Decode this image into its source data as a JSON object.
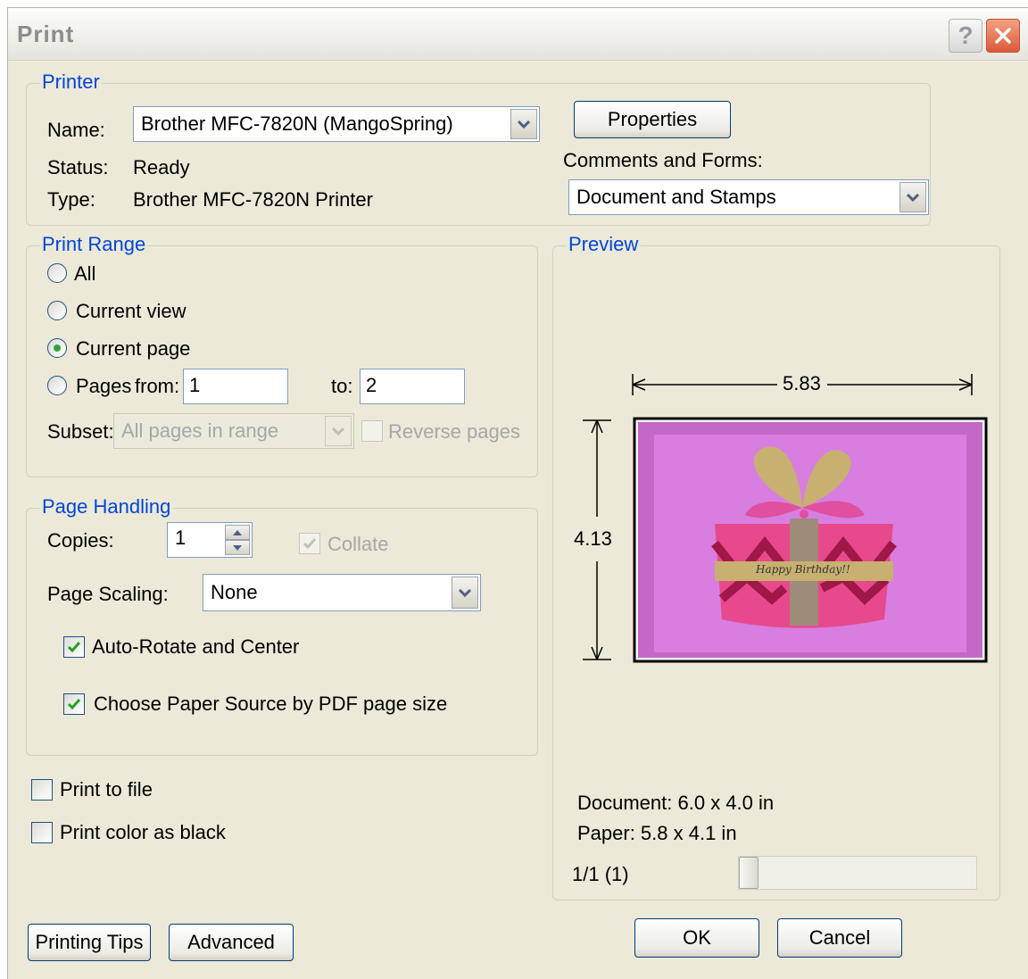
{
  "window": {
    "title": "Print"
  },
  "printer": {
    "legend": "Printer",
    "name_label": "Name:",
    "name_value": "Brother MFC-7820N (MangoSpring)",
    "status_label": "Status:",
    "status_value": "Ready",
    "type_label": "Type:",
    "type_value": "Brother MFC-7820N Printer",
    "properties_button": "Properties",
    "comments_label": "Comments and Forms:",
    "comments_value": "Document and Stamps"
  },
  "print_range": {
    "legend": "Print Range",
    "all": "All",
    "current_view": "Current view",
    "current_page": "Current page",
    "selected": "current_page",
    "pages": "Pages",
    "from_label": "from:",
    "from_value": "1",
    "to_label": "to:",
    "to_value": "2",
    "subset_label": "Subset:",
    "subset_value": "All pages in range",
    "reverse_label": "Reverse pages"
  },
  "page_handling": {
    "legend": "Page Handling",
    "copies_label": "Copies:",
    "copies_value": "1",
    "collate_label": "Collate",
    "scaling_label": "Page Scaling:",
    "scaling_value": "None",
    "auto_rotate_label": "Auto-Rotate and Center",
    "auto_rotate_checked": true,
    "paper_source_label": "Choose Paper Source by PDF page size",
    "paper_source_checked": true
  },
  "options": {
    "print_to_file": "Print to file",
    "print_color_black": "Print color as black"
  },
  "preview": {
    "legend": "Preview",
    "width_value": "5.83",
    "height_value": "4.13",
    "card_text": "Happy Birthday!!",
    "document_size": "Document: 6.0 x 4.0 in",
    "paper_size": "Paper: 5.8 x 4.1 in",
    "page_counter": "1/1 (1)"
  },
  "buttons": {
    "printing_tips": "Printing Tips",
    "advanced": "Advanced",
    "ok": "OK",
    "cancel": "Cancel"
  },
  "colors": {
    "legend_blue": "#0046d5",
    "dialog_bg": "#ece9d8",
    "card_pink": "#d87ee0",
    "check_green": "#21a121"
  }
}
